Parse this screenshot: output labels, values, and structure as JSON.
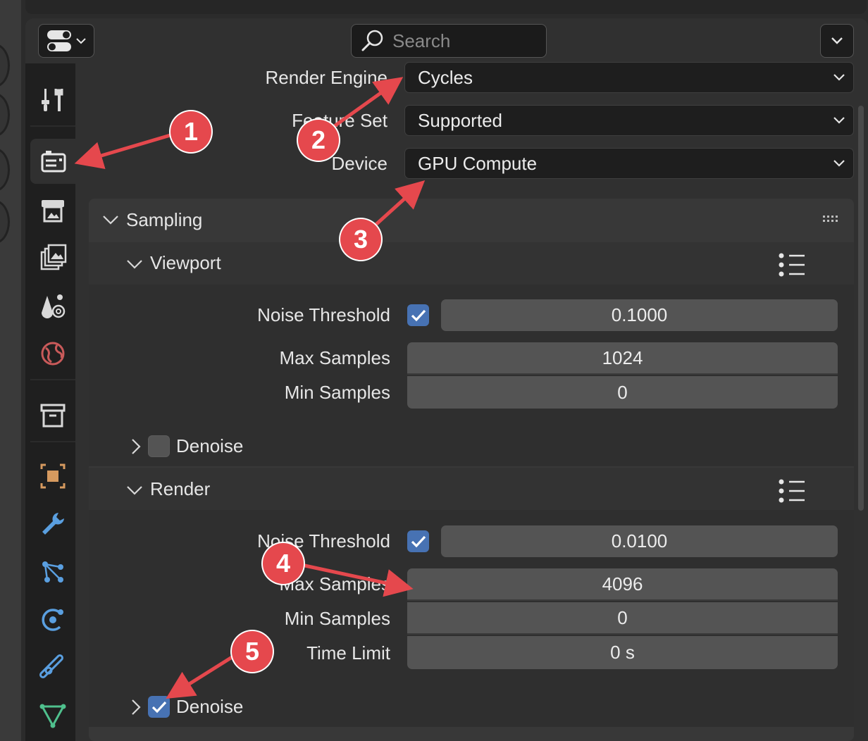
{
  "header": {
    "search_placeholder": "Search"
  },
  "tabs": [
    {
      "icon": "tool-icon"
    },
    {
      "icon": "render-icon",
      "active": true
    },
    {
      "icon": "output-icon"
    },
    {
      "icon": "view-layer-icon"
    },
    {
      "icon": "scene-icon"
    },
    {
      "icon": "world-icon"
    },
    {
      "icon": "collection-icon"
    },
    {
      "icon": "object-icon"
    },
    {
      "icon": "modifier-icon"
    },
    {
      "icon": "particles-icon"
    },
    {
      "icon": "physics-icon"
    },
    {
      "icon": "constraints-icon"
    },
    {
      "icon": "data-icon"
    }
  ],
  "render_settings": {
    "engine_label": "Render Engine",
    "engine_value": "Cycles",
    "feature_set_label": "Feature Set",
    "feature_set_value": "Supported",
    "device_label": "Device",
    "device_value": "GPU Compute"
  },
  "sampling": {
    "title": "Sampling",
    "viewport": {
      "title": "Viewport",
      "noise_threshold_label": "Noise Threshold",
      "noise_threshold_enabled": true,
      "noise_threshold_value": "0.1000",
      "max_samples_label": "Max Samples",
      "max_samples_value": "1024",
      "min_samples_label": "Min Samples",
      "min_samples_value": "0",
      "denoise_label": "Denoise",
      "denoise_enabled": false
    },
    "render": {
      "title": "Render",
      "noise_threshold_label": "Noise Threshold",
      "noise_threshold_enabled": true,
      "noise_threshold_value": "0.0100",
      "max_samples_label": "Max Samples",
      "max_samples_value": "4096",
      "min_samples_label": "Min Samples",
      "min_samples_value": "0",
      "time_limit_label": "Time Limit",
      "time_limit_value": "0 s",
      "denoise_label": "Denoise",
      "denoise_enabled": true
    }
  },
  "annotations": {
    "badge_1": "1",
    "badge_2": "2",
    "badge_3": "3",
    "badge_4": "4",
    "badge_5": "5",
    "color": "#e5484d"
  },
  "colors": {
    "accent_checkbox": "#4772b3",
    "panel_bg": "#303030",
    "field_bg": "#545454"
  }
}
